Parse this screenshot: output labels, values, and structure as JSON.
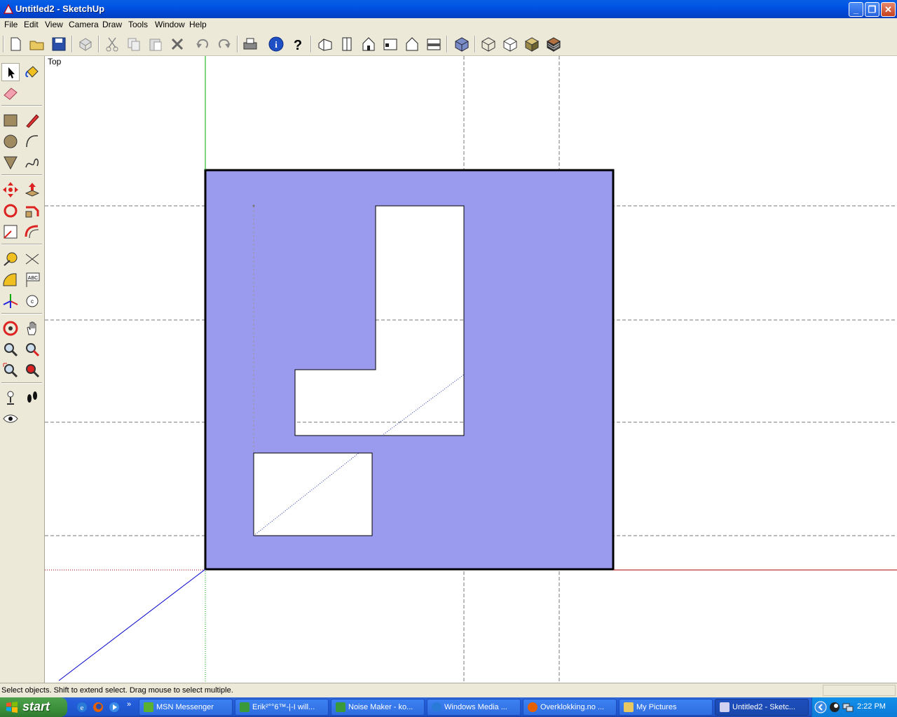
{
  "window": {
    "title": "Untitled2 - SketchUp"
  },
  "menu": [
    "File",
    "Edit",
    "View",
    "Camera",
    "Draw",
    "Tools",
    "Window",
    "Help"
  ],
  "viewport": {
    "view_label": "Top"
  },
  "status": {
    "text": "Select objects. Shift to extend select. Drag mouse to select multiple.",
    "vcb_value": ""
  },
  "taskbar": {
    "start_label": "start",
    "buttons": [
      {
        "label": "MSN Messenger",
        "icon": "msn-icon",
        "active": false
      },
      {
        "label": "Erik²°°6™-|-I will...",
        "icon": "chat-icon",
        "active": false
      },
      {
        "label": "Noise Maker - ko...",
        "icon": "chat-icon",
        "active": false
      },
      {
        "label": "Windows Media ...",
        "icon": "media-player-icon",
        "active": false
      },
      {
        "label": "Overklokking.no ...",
        "icon": "firefox-icon",
        "active": false
      },
      {
        "label": "My Pictures",
        "icon": "folder-icon",
        "active": false
      },
      {
        "label": "Untitled2 - Sketc...",
        "icon": "sketchup-icon",
        "active": true
      }
    ],
    "clock": "2:22 PM"
  },
  "colors": {
    "face": "#9a9aee",
    "title": "#0055e5",
    "red_axis": "#cc0000",
    "green_axis": "#00aa00",
    "blue_axis": "#0000cc"
  }
}
